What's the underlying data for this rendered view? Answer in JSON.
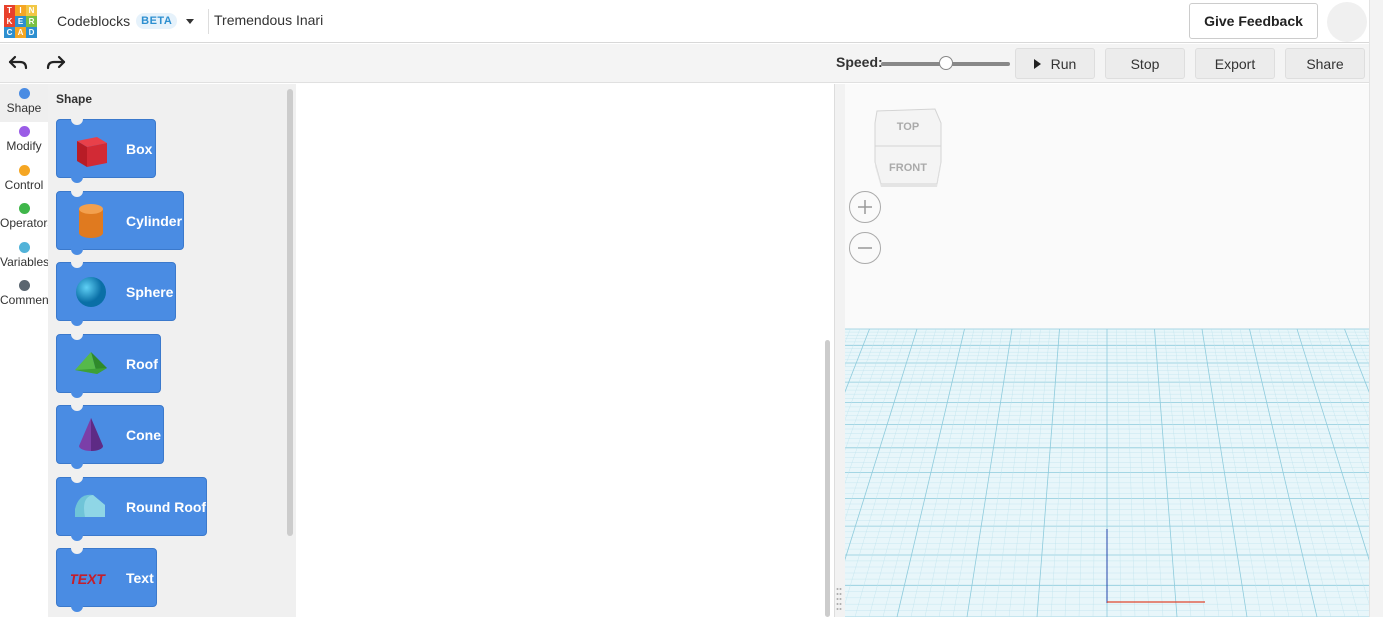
{
  "header": {
    "logo_letters": [
      "T",
      "I",
      "N",
      "K",
      "E",
      "R",
      "C",
      "A",
      "D"
    ],
    "logo_colors": [
      "#e8412c",
      "#f5a623",
      "#f2c744",
      "#e8412c",
      "#2d8fd0",
      "#7ac143",
      "#2d8fd0",
      "#f5a623",
      "#2d8fd0"
    ],
    "app_name": "Codeblocks",
    "beta_badge": "BETA",
    "design_name": "Tremendous Inari",
    "feedback_label": "Give Feedback"
  },
  "toolbar": {
    "speed_label": "Speed:",
    "speed_value": 0.5,
    "run_label": "Run",
    "stop_label": "Stop",
    "export_label": "Export",
    "share_label": "Share"
  },
  "categories": [
    {
      "label": "Shape",
      "color": "#4a8ce3",
      "active": true
    },
    {
      "label": "Modify",
      "color": "#9a5ce6",
      "active": false
    },
    {
      "label": "Control",
      "color": "#f5a623",
      "active": false
    },
    {
      "label": "Operators",
      "color": "#3fb64a",
      "active": false
    },
    {
      "label": "Variables",
      "color": "#52b3d9",
      "active": false
    },
    {
      "label": "Comment",
      "color": "#5b6670",
      "active": false
    }
  ],
  "flyout": {
    "title": "Shape",
    "blocks": [
      {
        "label": "Box",
        "icon": "box-icon"
      },
      {
        "label": "Cylinder",
        "icon": "cylinder-icon"
      },
      {
        "label": "Sphere",
        "icon": "sphere-icon"
      },
      {
        "label": "Roof",
        "icon": "roof-icon"
      },
      {
        "label": "Cone",
        "icon": "cone-icon"
      },
      {
        "label": "Round Roof",
        "icon": "round-roof-icon"
      },
      {
        "label": "Text",
        "icon": "text-shape-icon"
      }
    ]
  },
  "viewer": {
    "viewcube_top": "TOP",
    "viewcube_front": "FRONT",
    "grid_color": "#bfe3ee"
  }
}
